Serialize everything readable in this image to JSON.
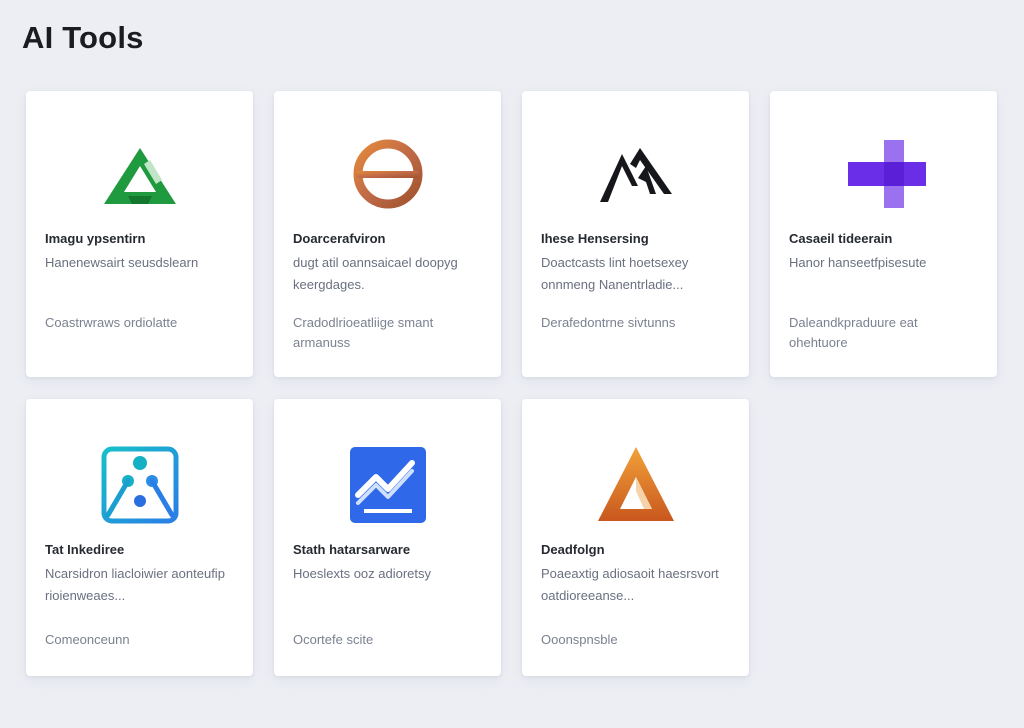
{
  "page": {
    "title": "AI Tools"
  },
  "cards": [
    {
      "name": "Imagu ypsentirn",
      "desc": "Hanenewsairt seusdslearn",
      "meta": "Coastrwraws ordiolatte",
      "icon": "green-triangle-logo-icon"
    },
    {
      "name": "Doarcerafviron",
      "desc": "dugt atil oannsaicael doopyg keergdages.",
      "meta": "Cradodlrioeatliige smant armanuss",
      "icon": "orange-ring-logo-icon"
    },
    {
      "name": "Ihese Hensersing",
      "desc": "Doactcasts lint hoetsexey onnmeng Nanentrladie...",
      "meta": "Derafedontrne sivtunns",
      "icon": "black-peaks-logo-icon"
    },
    {
      "name": "Casaeil tideerain",
      "desc": "Hanor hanseetfpisesute",
      "meta": "Daleandkpraduure eat ohehtuore",
      "icon": "purple-blocks-logo-icon"
    },
    {
      "name": "Tat Inkediree",
      "desc": "Ncarsidron liacloiwier aonteufip rioienweaes...",
      "meta": "Comeonceunn",
      "icon": "teal-nodes-logo-icon"
    },
    {
      "name": "Stath hatarsarware",
      "desc": "Hoeslexts ooz adioretsy",
      "meta": "Ocortefe scite",
      "icon": "blue-chart-logo-icon"
    },
    {
      "name": "Deadfolgn",
      "desc": "Poaeaxtig adiosaoit haesrsvort oatdioreeanse...",
      "meta": "Ooonspnsble",
      "icon": "orange-triangle-logo-icon"
    }
  ],
  "colors": {
    "background": "#eceef4",
    "card": "#ffffff",
    "green": "#1f9a3e",
    "orange": "#e07b2a",
    "purple": "#6a2ee8",
    "teal": "#16b0c4",
    "blue": "#2f68e8"
  }
}
